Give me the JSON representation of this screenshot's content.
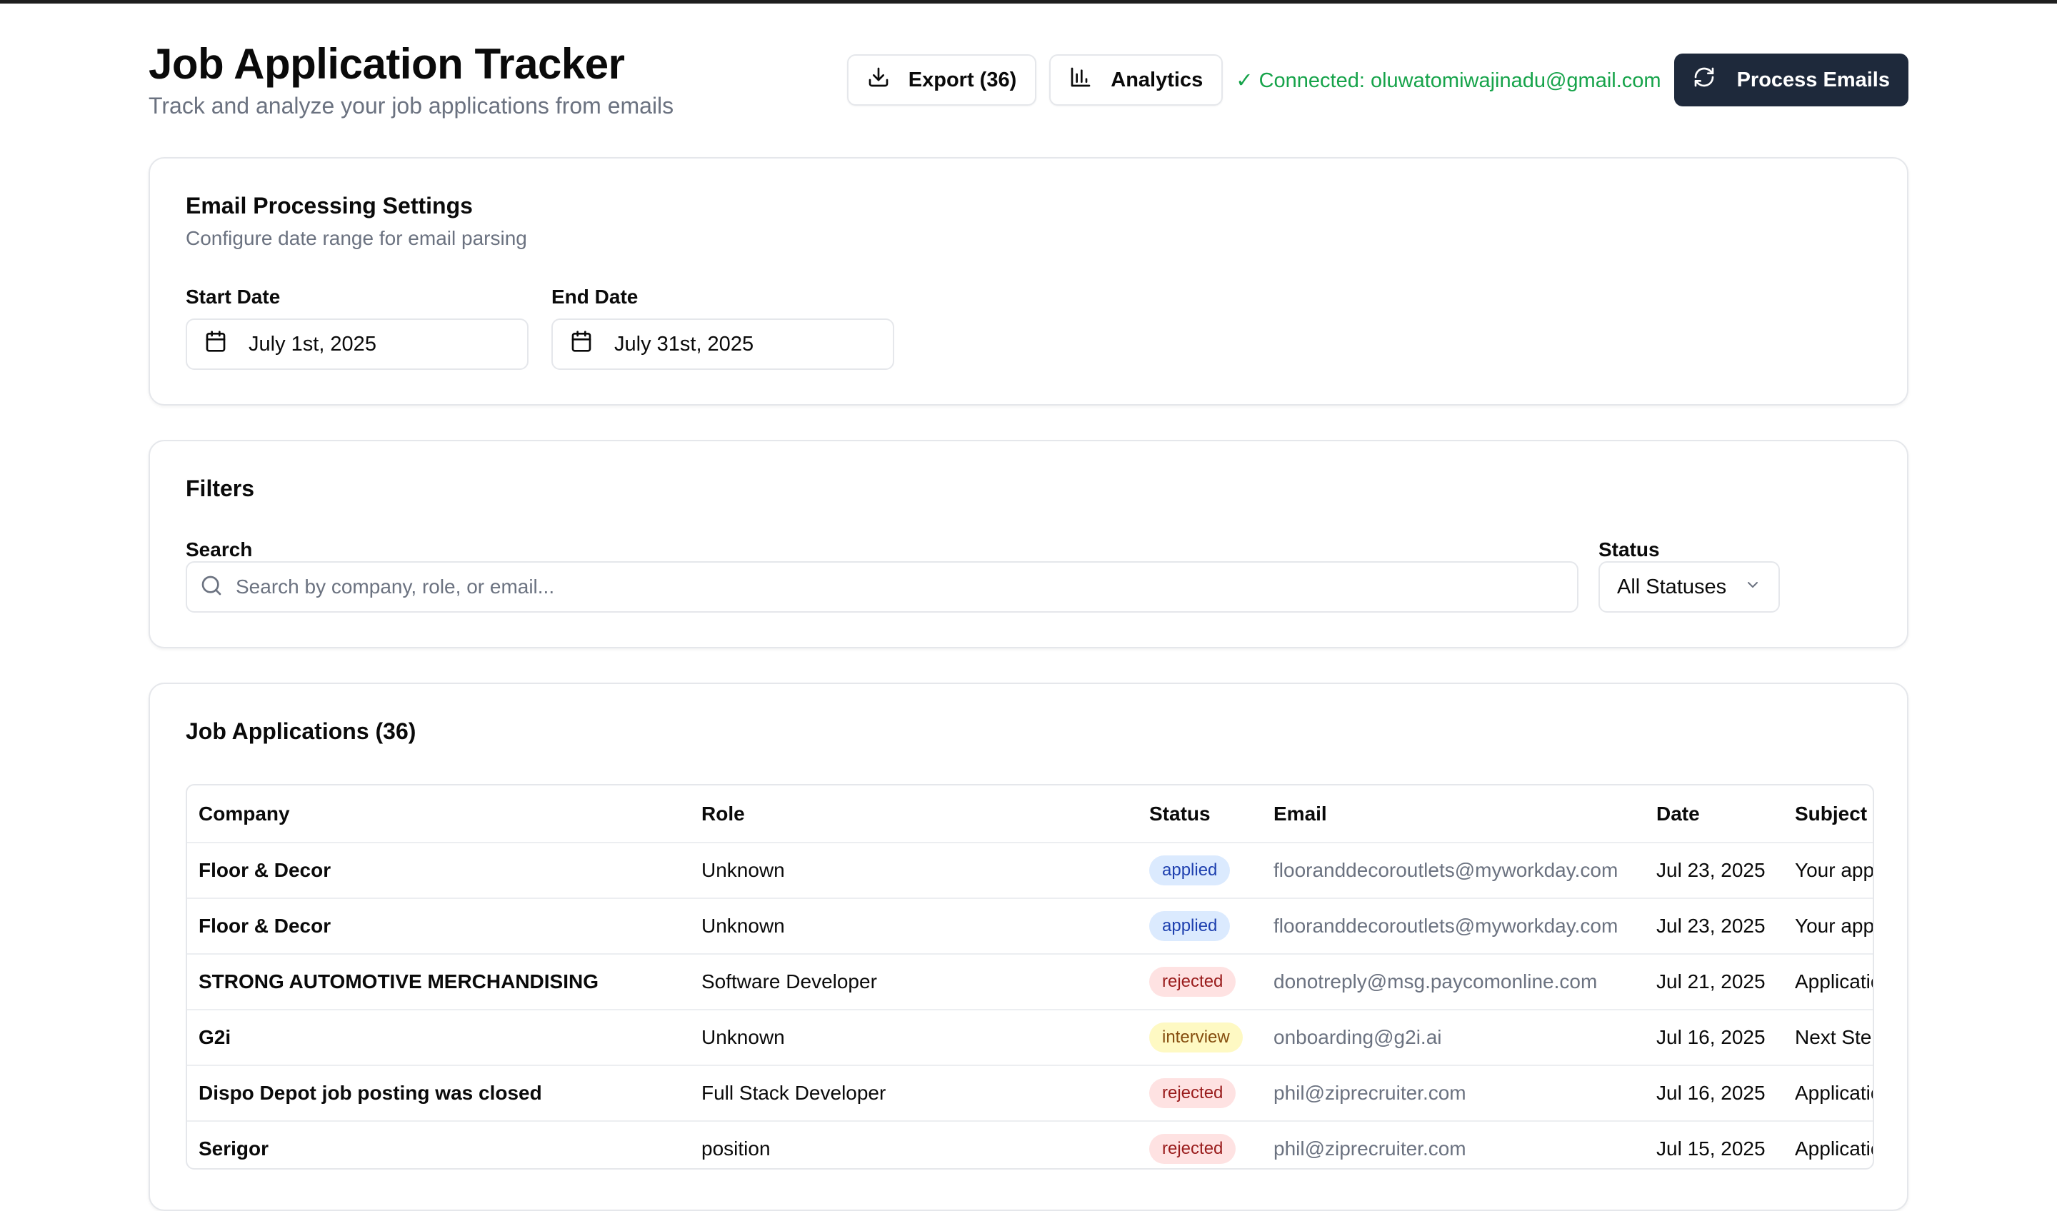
{
  "header": {
    "title": "Job Application Tracker",
    "subtitle": "Track and analyze your job applications from emails",
    "export_label": "Export (36)",
    "analytics_label": "Analytics",
    "connected_text": "✓ Connected: oluwatomiwajinadu@gmail.com",
    "process_label": "Process Emails"
  },
  "settings": {
    "title": "Email Processing Settings",
    "description": "Configure date range for email parsing",
    "start_label": "Start Date",
    "start_value": "July 1st, 2025",
    "end_label": "End Date",
    "end_value": "July 31st, 2025"
  },
  "filters": {
    "title": "Filters",
    "search_label": "Search",
    "search_placeholder": "Search by company, role, or email...",
    "status_label": "Status",
    "status_value": "All Statuses"
  },
  "applications": {
    "title": "Job Applications (36)",
    "columns": [
      "Company",
      "Role",
      "Status",
      "Email",
      "Date",
      "Subject"
    ],
    "rows": [
      {
        "company": "Floor & Decor",
        "role": "Unknown",
        "status": "applied",
        "email": "flooranddecoroutlets@myworkday.com",
        "date": "Jul 23, 2025",
        "subject": "Your application"
      },
      {
        "company": "Floor & Decor",
        "role": "Unknown",
        "status": "applied",
        "email": "flooranddecoroutlets@myworkday.com",
        "date": "Jul 23, 2025",
        "subject": "Your application"
      },
      {
        "company": "STRONG AUTOMOTIVE MERCHANDISING",
        "role": "Software Developer",
        "status": "rejected",
        "email": "donotreply@msg.paycomonline.com",
        "date": "Jul 21, 2025",
        "subject": "Application"
      },
      {
        "company": "G2i",
        "role": "Unknown",
        "status": "interview",
        "email": "onboarding@g2i.ai",
        "date": "Jul 16, 2025",
        "subject": "Next Steps"
      },
      {
        "company": "Dispo Depot job posting was closed",
        "role": "Full Stack Developer",
        "status": "rejected",
        "email": "phil@ziprecruiter.com",
        "date": "Jul 16, 2025",
        "subject": "Application"
      },
      {
        "company": "Serigor",
        "role": "position",
        "status": "rejected",
        "email": "phil@ziprecruiter.com",
        "date": "Jul 15, 2025",
        "subject": "Application"
      }
    ]
  },
  "colors": {
    "primary_dark": "#1e293b",
    "connected_green": "#16a34a",
    "applied_bg": "#dbeafe",
    "rejected_bg": "#fee2e2",
    "interview_bg": "#fef9c3"
  }
}
